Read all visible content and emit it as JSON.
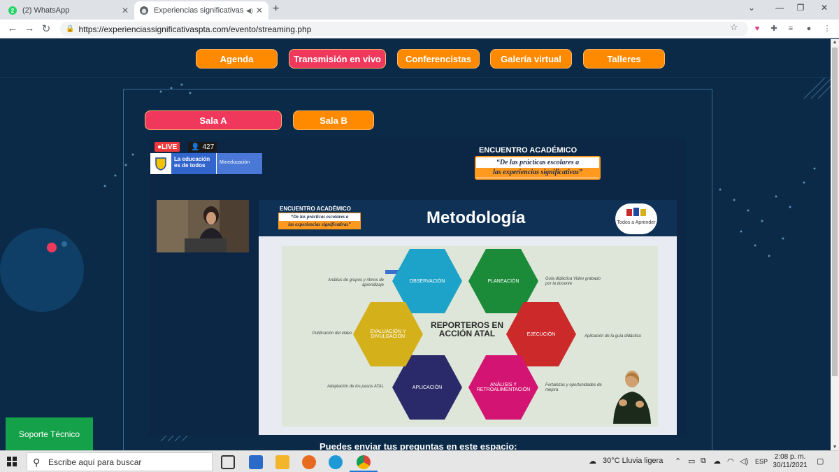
{
  "browser": {
    "tabs": [
      {
        "title": "(2) WhatsApp",
        "active": false
      },
      {
        "title": "Experiencias significativas PTA",
        "active": true
      }
    ],
    "url": "https://experienciassignificativaspta.com/evento/streaming.php"
  },
  "site_nav": {
    "items": [
      "Agenda",
      "Transmisión en vivo",
      "Conferencistas",
      "Galería virtual",
      "Talleres"
    ]
  },
  "rooms": [
    "Sala A",
    "Sala B"
  ],
  "stream": {
    "live_label": "LIVE",
    "viewers": "427",
    "gov_logo_text": "La educación es de todos",
    "gov_logo_right": "Mineducación",
    "event_title": "ENCUENTRO ACADÉMICO",
    "event_subtitle_1": "“De las prácticas escolares a",
    "event_subtitle_2": "las experiencias significativas”"
  },
  "slide": {
    "title": "Metodología",
    "header_event": "ENCUENTRO ACADÉMICO",
    "header_sub_1": "“De las prácticas escolares a",
    "header_sub_2": "las experiencias significativas”",
    "logo_text_1": "Todos a",
    "logo_text_2": "Aprender",
    "center": "REPORTEROS EN ACCIÓN ATAL",
    "hexes": [
      {
        "label": "OBSERVACIÓN",
        "color": "#1da3c9"
      },
      {
        "label": "PLANEACIÓN",
        "color": "#1b8b3a"
      },
      {
        "label": "EJECUCIÓN",
        "color": "#cc2a2a"
      },
      {
        "label": "ANÁLISIS Y RETROALIMENTACIÓN",
        "color": "#d41473"
      },
      {
        "label": "APLICACIÓN",
        "color": "#2a2a6a"
      },
      {
        "label": "EVALUACIÓN Y DIVULGACIÓN",
        "color": "#d4b01a"
      }
    ],
    "notes": {
      "observacion": "Análisis de grupos y ritmos de aprendizaje",
      "planeacion": "Guía didáctica Video grabado por la docente",
      "ejecucion": "Aplicación de la guía didáctica",
      "analisis": "Fortalezas y oportunidades de mejora",
      "aplicacion": "Adaptación de los pasos ATAL",
      "evaluacion": "Publicación del video"
    }
  },
  "questions_prompt": "Puedes enviar tus preguntas en este espacio:",
  "support_button": "Soporte Técnico",
  "taskbar": {
    "search_placeholder": "Escribe aquí para buscar",
    "weather": "30°C  Lluvia ligera",
    "lang": "ESP",
    "time": "2:08 p. m.",
    "date": "30/11/2021"
  }
}
